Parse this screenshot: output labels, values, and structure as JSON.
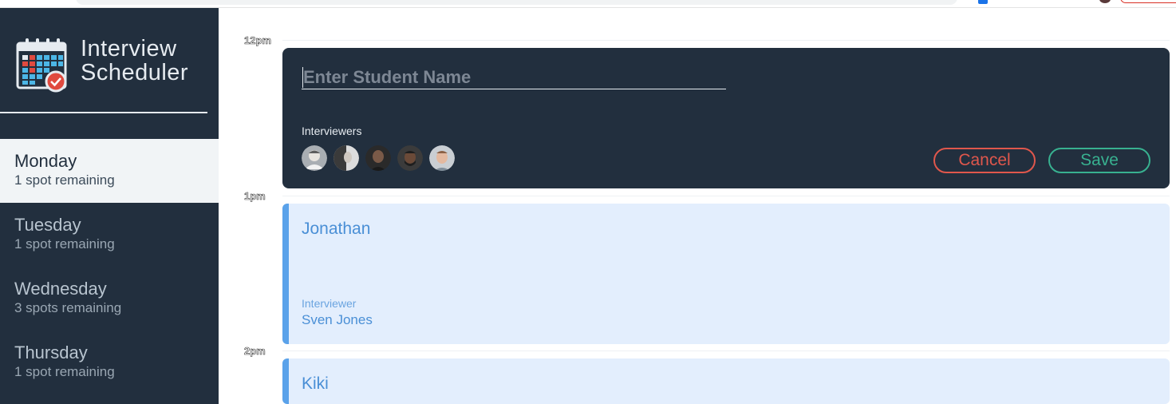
{
  "app": {
    "title_line1": "Interview",
    "title_line2": "Scheduler",
    "logo_icon": "calendar-check-icon"
  },
  "sidebar": {
    "days": [
      {
        "name": "Monday",
        "spots": "1 spot remaining",
        "selected": true
      },
      {
        "name": "Tuesday",
        "spots": "1 spot remaining",
        "selected": false
      },
      {
        "name": "Wednesday",
        "spots": "3 spots remaining",
        "selected": false
      },
      {
        "name": "Thursday",
        "spots": "1 spot remaining",
        "selected": false
      }
    ]
  },
  "schedule": {
    "times": [
      "12pm",
      "1pm",
      "2pm"
    ],
    "form": {
      "placeholder": "Enter Student Name",
      "value": "",
      "interviewers_label": "Interviewers",
      "avatars": [
        "interviewer-avatar-1",
        "interviewer-avatar-2",
        "interviewer-avatar-3",
        "interviewer-avatar-4",
        "interviewer-avatar-5"
      ],
      "cancel_label": "Cancel",
      "save_label": "Save"
    },
    "appointments": [
      {
        "student": "Jonathan",
        "interviewer_label": "Interviewer",
        "interviewer": "Sven Jones"
      },
      {
        "student": "Kiki"
      }
    ]
  },
  "colors": {
    "sidebar_bg": "#222f3e",
    "selected_day_bg": "#f1f4f6",
    "cancel": "#e0574c",
    "save": "#38b190",
    "appointment_bg": "#e3eefd",
    "appointment_accent": "#5aa2ea"
  }
}
